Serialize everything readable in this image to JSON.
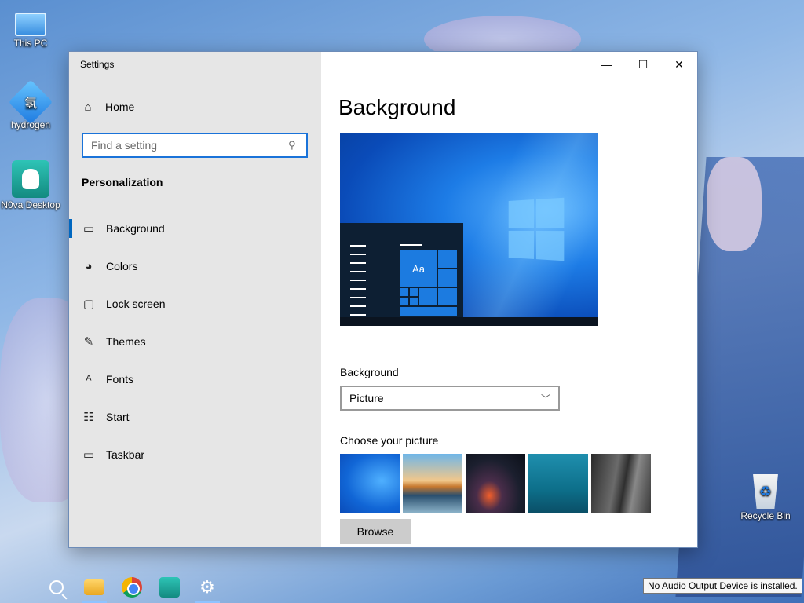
{
  "desktop": {
    "icons": [
      {
        "label": "This PC",
        "icon": "computer-icon"
      },
      {
        "label": "hydrogen",
        "icon": "hydrogen-app-icon",
        "glyph": "氢"
      },
      {
        "label": "N0va Desktop",
        "icon": "nova-desktop-icon"
      },
      {
        "label": "Recycle Bin",
        "icon": "recycle-bin-icon"
      }
    ]
  },
  "window": {
    "title": "Settings",
    "controls": {
      "minimize": "—",
      "maximize": "☐",
      "close": "✕"
    }
  },
  "sidebar": {
    "home_label": "Home",
    "search_placeholder": "Find a setting",
    "section": "Personalization",
    "items": [
      {
        "label": "Background",
        "icon": "picture-icon",
        "active": true
      },
      {
        "label": "Colors",
        "icon": "palette-icon"
      },
      {
        "label": "Lock screen",
        "icon": "lock-screen-icon"
      },
      {
        "label": "Themes",
        "icon": "themes-icon"
      },
      {
        "label": "Fonts",
        "icon": "fonts-icon"
      },
      {
        "label": "Start",
        "icon": "start-icon"
      },
      {
        "label": "Taskbar",
        "icon": "taskbar-icon"
      }
    ]
  },
  "main": {
    "title": "Background",
    "preview_sample": "Aa",
    "background_label": "Background",
    "background_value": "Picture",
    "choose_label": "Choose your picture",
    "browse_label": "Browse"
  },
  "taskbar": {
    "items": [
      "search-icon",
      "file-explorer-icon",
      "chrome-icon",
      "nova-desktop-icon",
      "settings-gear-icon"
    ]
  },
  "tooltip": "No Audio Output Device is installed.",
  "colors": {
    "accent": "#0067c0",
    "search_border": "#1a73d9",
    "sidebar_bg": "#e6e6e6"
  }
}
